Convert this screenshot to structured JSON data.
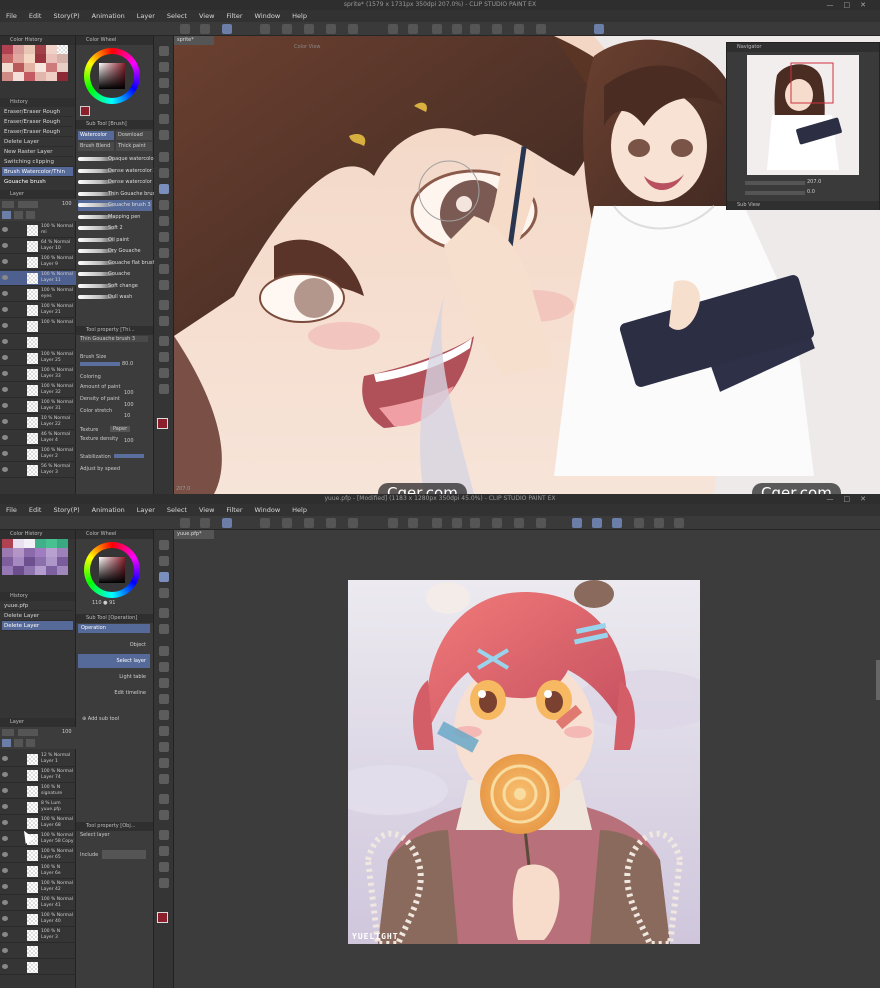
{
  "top": {
    "title": "sprite* (1579 x 1731px 350dpi 207.0%) - CLIP STUDIO PAINT EX",
    "menu": [
      "File",
      "Edit",
      "Story(P)",
      "Animation",
      "Layer",
      "Select",
      "View",
      "Filter",
      "Window",
      "Help"
    ],
    "doc_tab": "sprite*",
    "color_history_label": "Color History",
    "color_wheel_label": "Color Wheel",
    "history_label": "History",
    "history_items": [
      "Eraser/Eraser Rough",
      "Eraser/Eraser Rough",
      "Eraser/Eraser Rough",
      "Delete Layer",
      "New Raster Layer",
      "Switching clipping",
      "Brush Watercolor/Thin Gouache brush"
    ],
    "history_selected": 6,
    "layer_label": "Layer",
    "layer_opacity": "100",
    "layers": [
      {
        "l1": "100 % Normal",
        "l2": "mi"
      },
      {
        "l1": "64 % Normal",
        "l2": "Layer 10"
      },
      {
        "l1": "100 % Normal",
        "l2": "Layer 9"
      },
      {
        "l1": "100 % Normal",
        "l2": "Layer 11"
      },
      {
        "l1": "100 % Normal",
        "l2": "eyes"
      },
      {
        "l1": "100 % Normal",
        "l2": "Layer 21"
      },
      {
        "l1": "100 % Normal",
        "l2": ""
      },
      {
        "l1": "",
        "l2": ""
      },
      {
        "l1": "100 % Normal",
        "l2": "Layer 25"
      },
      {
        "l1": "100 % Normal",
        "l2": "Layer 33"
      },
      {
        "l1": "100 % Normal",
        "l2": "Layer 32"
      },
      {
        "l1": "100 % Normal",
        "l2": "Layer 31"
      },
      {
        "l1": "10 % Normal",
        "l2": "Layer 22"
      },
      {
        "l1": "46 % Normal",
        "l2": "Layer 4"
      },
      {
        "l1": "100 % Normal",
        "l2": "Layer 2"
      },
      {
        "l1": "56 % Normal",
        "l2": "Layer 3"
      }
    ],
    "layer_selected": 3,
    "subtool_label": "Sub Tool [Brush]",
    "brush_tabs": [
      "Watercolor",
      "Download",
      "Brush Blend",
      "Thick paint"
    ],
    "brushes": [
      "Opaque watercolor",
      "Dense watercolor 2",
      "Dense watercolor",
      "Thin Gouache brush",
      "Gouache brush 3",
      "Mapping pen",
      "Soft 2",
      "Oil paint",
      "Dry Gouache",
      "Gouache flat brush",
      "Gouache",
      "Soft change",
      "Dull wash"
    ],
    "brush_selected": 4,
    "toolprop_label": "Tool property [Thi...",
    "toolprop_brush": "Thin Gouache brush 3",
    "brush_size_label": "Brush Size",
    "brush_size": "80.0",
    "coloring_label": "Coloring",
    "amount_label": "Amount of paint",
    "amount_val": "100",
    "density_label": "Density of paint",
    "density_val": "100",
    "stretch_label": "Color stretch",
    "stretch_val": "10",
    "texture_label": "Texture",
    "texture_val": "Paper",
    "texture_density_label": "Texture density",
    "texture_density_val": "100",
    "stabilization_label": "Stabilization",
    "adjust_speed_label": "Adjust by speed",
    "color_view_label": "Color View",
    "navigator_label": "Navigator",
    "zoom_val": "207.0",
    "angle_val": "0.0",
    "subview_label": "Sub View",
    "status_zoom": "207.0",
    "watermark": "Cger.com"
  },
  "bottom": {
    "title": "yuue.pfp - [Modified] (1183 x 1280px 350dpi 45.0%) - CLIP STUDIO PAINT EX",
    "menu": [
      "File",
      "Edit",
      "Story(P)",
      "Animation",
      "Layer",
      "Select",
      "View",
      "Filter",
      "Window",
      "Help"
    ],
    "doc_tab": "yuue.pfp*",
    "color_history_label": "Color History",
    "color_wheel_label": "Color Wheel",
    "rgb_readout": "110 ● 91",
    "history_label": "History",
    "history_items": [
      "yuue.pfp",
      "Delete Layer",
      "Delete Layer"
    ],
    "history_selected": 2,
    "subtool_label": "Sub Tool [Operation]",
    "operation_label": "Operation",
    "op_items": [
      "Object",
      "Select layer",
      "Light table",
      "Edit timeline"
    ],
    "op_selected": 1,
    "add_subtool": "Add sub tool",
    "layer_label": "Layer",
    "layer_opacity": "100",
    "layers": [
      {
        "l1": "12 % Normal",
        "l2": "Layer 1"
      },
      {
        "l1": "100 % Normal",
        "l2": "Layer 74"
      },
      {
        "l1": "100 % N",
        "l2": "signature"
      },
      {
        "l1": "8 % Lum",
        "l2": "yuue.pfp"
      },
      {
        "l1": "100 % Normal",
        "l2": "Layer 68"
      },
      {
        "l1": "100 % Normal",
        "l2": "Layer 58 Copy"
      },
      {
        "l1": "100 % Normal",
        "l2": "Layer 65"
      },
      {
        "l1": "100 % N",
        "l2": "Layer 6e"
      },
      {
        "l1": "100 % Normal",
        "l2": "Layer 42"
      },
      {
        "l1": "100 % Normal",
        "l2": "Layer 41"
      },
      {
        "l1": "100 % Normal",
        "l2": "Layer 40"
      },
      {
        "l1": "100 % N",
        "l2": "Layer 3"
      },
      {
        "l1": "",
        "l2": ""
      },
      {
        "l1": "",
        "l2": ""
      }
    ],
    "toolprop_label": "Tool property [Obj...",
    "toolprop_item": "Select layer",
    "include_label": "Include",
    "artwork_signature": "YUELIGHT"
  },
  "colors": {
    "accent": "#556a98",
    "panel_bg": "#353535",
    "canvas_bg": "#444444",
    "current_color": "#8b1f2c"
  }
}
